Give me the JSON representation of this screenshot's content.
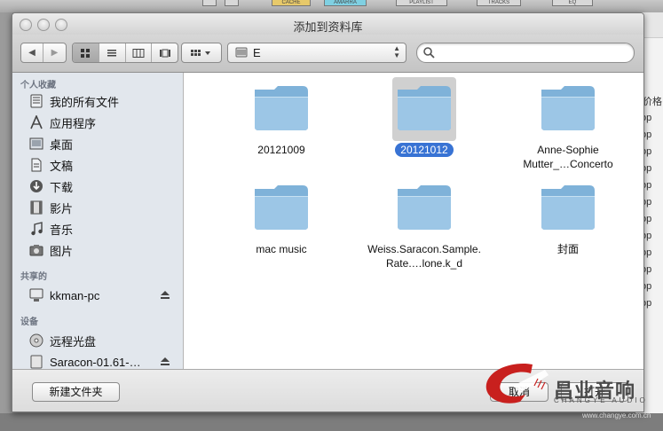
{
  "background": {
    "tabs": [
      "",
      "",
      "CACHE",
      "AMARRA",
      "PLAYLIST",
      "TRACKS",
      "EQ"
    ],
    "right_column_header": "价格",
    "right_column_rows": [
      "op",
      "op",
      "op",
      "op",
      "op",
      "op",
      "op",
      "op",
      "op",
      "op",
      "op",
      "op"
    ]
  },
  "window": {
    "title": "添加到资料库"
  },
  "toolbar": {
    "back_label": "◀",
    "forward_label": "▶",
    "path_label": "E",
    "search_placeholder": ""
  },
  "sidebar": {
    "sections": [
      {
        "title": "个人收藏",
        "items": [
          {
            "label": "我的所有文件",
            "icon": "all-files-icon"
          },
          {
            "label": "应用程序",
            "icon": "applications-icon"
          },
          {
            "label": "桌面",
            "icon": "desktop-icon"
          },
          {
            "label": "文稿",
            "icon": "documents-icon"
          },
          {
            "label": "下载",
            "icon": "downloads-icon"
          },
          {
            "label": "影片",
            "icon": "movies-icon"
          },
          {
            "label": "音乐",
            "icon": "music-icon"
          },
          {
            "label": "图片",
            "icon": "pictures-icon"
          }
        ]
      },
      {
        "title": "共享的",
        "items": [
          {
            "label": "kkman-pc",
            "icon": "computer-icon"
          }
        ]
      },
      {
        "title": "设备",
        "items": [
          {
            "label": "远程光盘",
            "icon": "remote-disc-icon"
          },
          {
            "label": "Saracon-01.61-…",
            "icon": "drive-icon"
          }
        ]
      }
    ]
  },
  "files": [
    {
      "name": "20121009",
      "selected": false
    },
    {
      "name": "20121012",
      "selected": true
    },
    {
      "name": "Anne-Sophie Mutter_…Concerto",
      "selected": false
    },
    {
      "name": "mac music",
      "selected": false
    },
    {
      "name": "Weiss.Saracon.Sample.Rate.…lone.k_d",
      "selected": false
    },
    {
      "name": "封面",
      "selected": false
    }
  ],
  "buttons": {
    "new_folder": "新建文件夹",
    "cancel": "取消",
    "open": "打开"
  },
  "watermark": {
    "brand": "昌业音响",
    "sub": "CHANGYE AUDIO",
    "url": "www.changye.com.cn"
  },
  "colors": {
    "selection": "#3873d4",
    "sidebar_bg": "#e2e7ed",
    "folder_blue": "#8fbde0"
  }
}
